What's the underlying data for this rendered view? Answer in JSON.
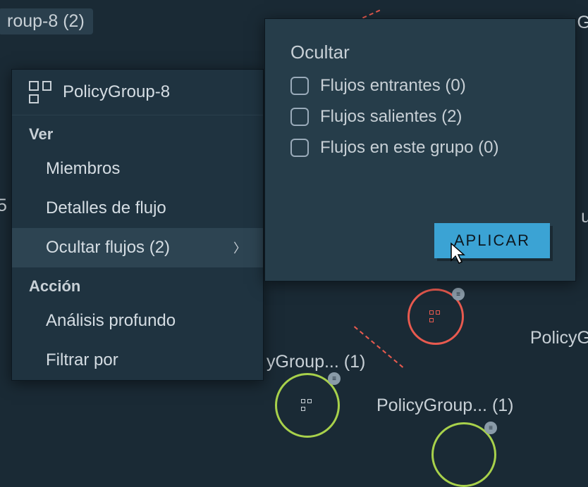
{
  "bg": {
    "topLeft": "roup-8 (2)",
    "topRight": "G",
    "leftMid": "5",
    "rightMid": "u",
    "rightLower": "PolicyG",
    "midBottom": "yGroup... (1)",
    "bottom": "PolicyGroup... (1)"
  },
  "menu": {
    "title": "PolicyGroup-8",
    "sections": {
      "view": {
        "label": "Ver",
        "items": [
          {
            "label": "Miembros"
          },
          {
            "label": "Detalles de flujo"
          },
          {
            "label": "Ocultar flujos (2)",
            "hasSubmenu": true,
            "active": true
          }
        ]
      },
      "action": {
        "label": "Acción",
        "items": [
          {
            "label": "Análisis profundo"
          },
          {
            "label": "Filtrar por"
          }
        ]
      }
    }
  },
  "submenu": {
    "title": "Ocultar",
    "options": [
      {
        "label": "Flujos entrantes (0)"
      },
      {
        "label": "Flujos salientes (2)"
      },
      {
        "label": "Flujos en este grupo (0)"
      }
    ],
    "applyLabel": "APLICAR"
  }
}
